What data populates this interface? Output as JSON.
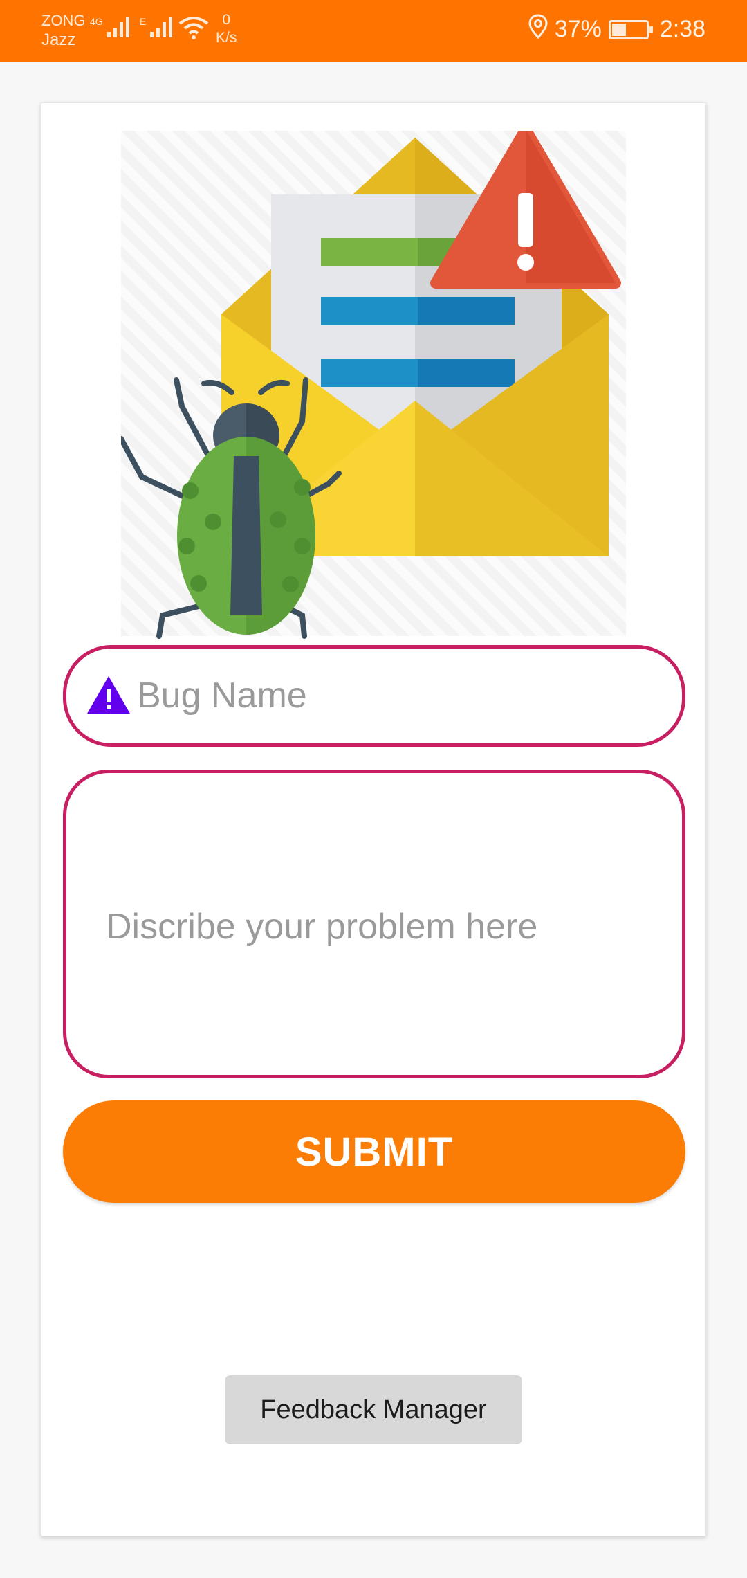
{
  "status_bar": {
    "carrier_line1": "ZONG",
    "carrier_line2": "Jazz",
    "network_4g": "4G",
    "network_e": "E",
    "speed_value": "0",
    "speed_unit": "K/s",
    "battery_percent": "37%",
    "time": "2:38",
    "icons": [
      "signal-icon",
      "wifi-icon",
      "location-icon",
      "battery-icon"
    ]
  },
  "form": {
    "bug_name_placeholder": "Bug Name",
    "bug_name_value": "",
    "description_placeholder": "Discribe your problem here",
    "description_value": "",
    "submit_label": "SUBMIT"
  },
  "footer": {
    "feedback_manager_label": "Feedback Manager"
  },
  "colors": {
    "status_bar": "#ff7400",
    "accent_orange": "#fb7d06",
    "field_border": "#c81f62",
    "warning_icon": "#6200ee"
  }
}
